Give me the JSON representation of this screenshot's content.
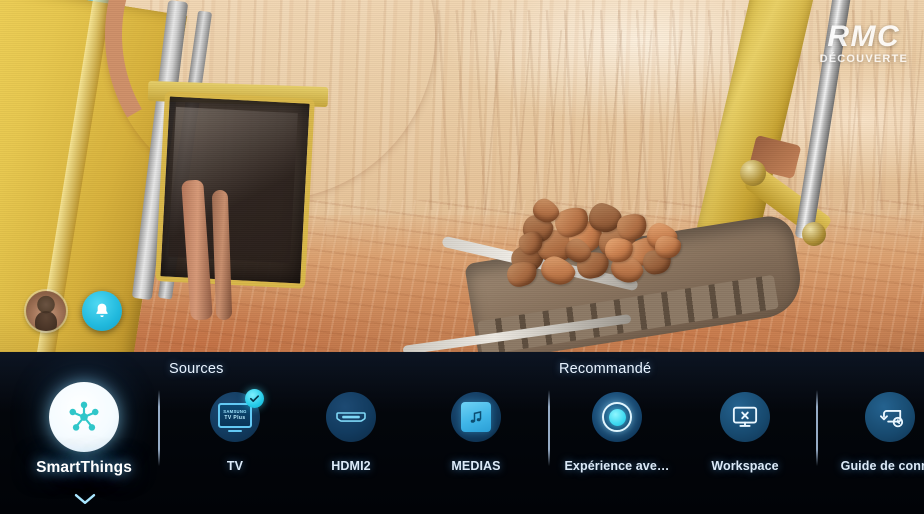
{
  "video_overlay": {
    "channel_logo": {
      "main": "RMC",
      "sub": "DÉCOUVERTE"
    },
    "avatar": {
      "name": "avatar",
      "alt": "User profile photo"
    },
    "notification_button": {
      "icon": "bell-icon",
      "label": ""
    }
  },
  "menu": {
    "sections": [
      {
        "id": "sources",
        "label": "Sources"
      },
      {
        "id": "recommande",
        "label": "Recommandé"
      }
    ],
    "selected_tile": "SmartThings",
    "tiles": [
      {
        "label": "SmartThings",
        "icon": "smartthings-icon",
        "section": "home",
        "selected": true,
        "badge": null
      },
      {
        "label": "TV",
        "icon": "tv-icon",
        "section": "sources",
        "selected": false,
        "badge": "check-badge",
        "screen_text": {
          "brand": "SAMSUNG",
          "service": "TV Plus"
        }
      },
      {
        "label": "HDMI2",
        "icon": "hdmi-port-icon",
        "section": "sources",
        "selected": false,
        "badge": null
      },
      {
        "label": "MEDIAS",
        "icon": "music-note-icon",
        "section": "sources",
        "selected": false,
        "badge": null
      },
      {
        "label": "Expérience ave…",
        "icon": "ambient-circle-icon",
        "section": "recommande",
        "selected": false,
        "badge": null
      },
      {
        "label": "Workspace",
        "icon": "monitor-x-icon",
        "section": "recommande",
        "selected": false,
        "badge": null
      },
      {
        "label": "Guide de conne.",
        "icon": "connection-guide-icon",
        "section": "recommande",
        "selected": false,
        "badge": null
      }
    ],
    "expand_chevron": {
      "icon": "chevron-down-icon",
      "label": ""
    }
  },
  "colors": {
    "accent_cyan": "#3ed9f0",
    "panel_background": "#03060b",
    "label_text": "#dceaf8",
    "icon_circle_dark": "#123b5f",
    "divider": "#afc8e6",
    "selected_glow": "#7ecdff"
  }
}
